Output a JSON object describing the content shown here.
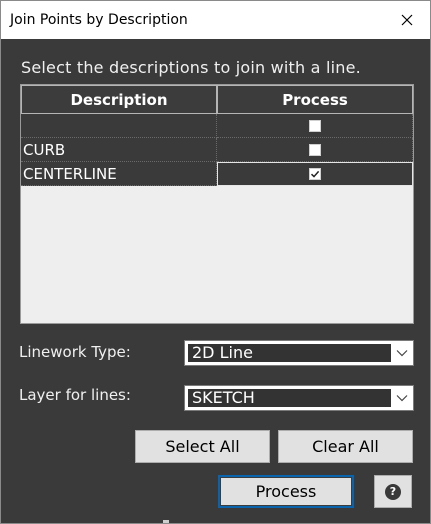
{
  "window": {
    "title": "Join Points by Description",
    "close_icon": "close-icon"
  },
  "instructions": "Select the descriptions to join with a line.",
  "grid": {
    "columns": [
      "Description",
      "Process"
    ],
    "rows": [
      {
        "description": "",
        "process": false
      },
      {
        "description": "CURB",
        "process": false
      },
      {
        "description": "CENTERLINE",
        "process": true
      }
    ],
    "selected_row": 2
  },
  "linework": {
    "label": "Linework Type:",
    "value": "2D Line"
  },
  "layer": {
    "label": "Layer for lines:",
    "value": "SKETCH"
  },
  "buttons": {
    "select_all": "Select All",
    "clear_all": "Clear All",
    "process": "Process",
    "help_icon": "help-icon",
    "help_glyph": "?"
  },
  "colors": {
    "background": "#3a3a3a",
    "accent": "#0a64ad",
    "button": "#e1e1e1"
  }
}
